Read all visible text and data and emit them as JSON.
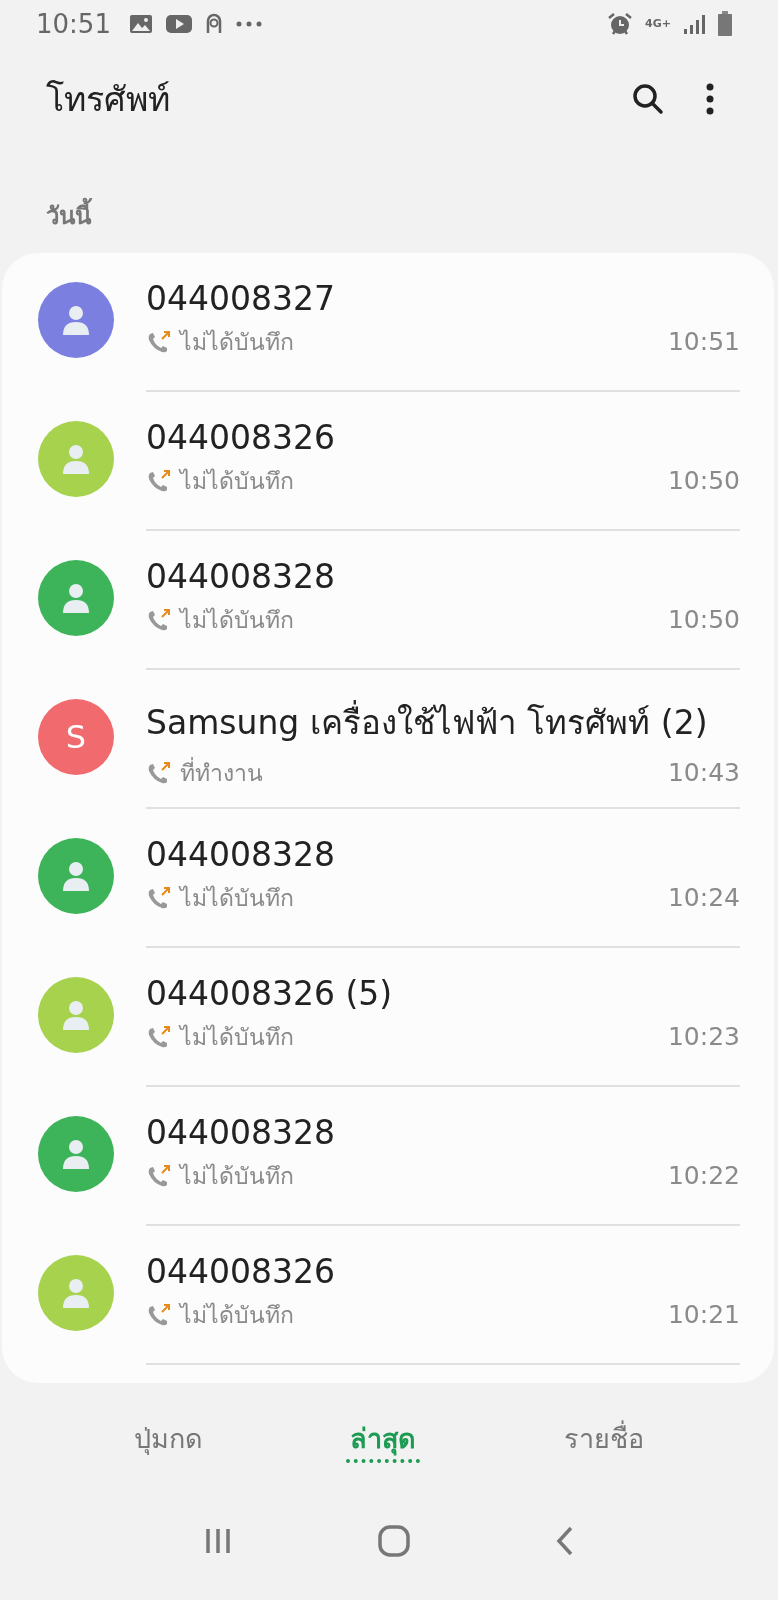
{
  "status_bar": {
    "time": "10:51",
    "network": "4G+"
  },
  "app_bar": {
    "title": "โทรศัพท์"
  },
  "section": "วันนี้",
  "calls": [
    {
      "name": "044008327",
      "label": "ไม่ได้บันทึก",
      "time": "10:51",
      "avatar": {
        "kind": "person",
        "color": "#7b7fe0"
      }
    },
    {
      "name": "044008326",
      "label": "ไม่ได้บันทึก",
      "time": "10:50",
      "avatar": {
        "kind": "person",
        "color": "#a6d24e"
      }
    },
    {
      "name": "044008328",
      "label": "ไม่ได้บันทึก",
      "time": "10:50",
      "avatar": {
        "kind": "person",
        "color": "#3db45a"
      }
    },
    {
      "name": "Samsung เครื่องใช้ไฟฟ้า โทรศัพท์ (2)",
      "label": "ที่ทำงาน",
      "time": "10:43",
      "avatar": {
        "kind": "letter",
        "text": "S",
        "color": "#f06a6e"
      }
    },
    {
      "name": "044008328",
      "label": "ไม่ได้บันทึก",
      "time": "10:24",
      "avatar": {
        "kind": "person",
        "color": "#3db45a"
      }
    },
    {
      "name": "044008326 (5)",
      "label": "ไม่ได้บันทึก",
      "time": "10:23",
      "avatar": {
        "kind": "person",
        "color": "#a6d24e"
      }
    },
    {
      "name": "044008328",
      "label": "ไม่ได้บันทึก",
      "time": "10:22",
      "avatar": {
        "kind": "person",
        "color": "#3db45a"
      }
    },
    {
      "name": "044008326",
      "label": "ไม่ได้บันทึก",
      "time": "10:21",
      "avatar": {
        "kind": "person",
        "color": "#a6d24e"
      }
    }
  ],
  "tabs": [
    {
      "label": "ปุ่มกด",
      "selected": false
    },
    {
      "label": "ล่าสุด",
      "selected": true
    },
    {
      "label": "รายชื่อ",
      "selected": false
    }
  ]
}
